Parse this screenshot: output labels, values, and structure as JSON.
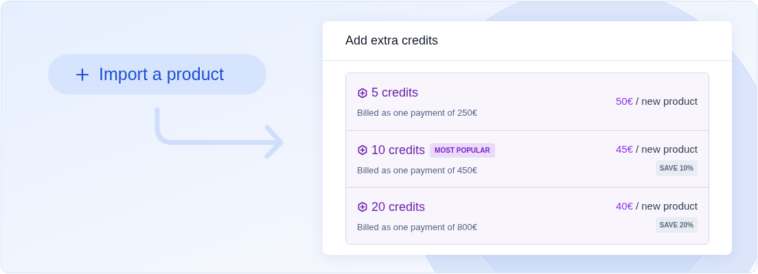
{
  "import_button": {
    "label": "Import a product"
  },
  "card": {
    "title": "Add extra credits",
    "plans": [
      {
        "name": "5 credits",
        "billing": "Billed as one payment of 250€",
        "price": "50€",
        "unit": "/ new product"
      },
      {
        "name": "10 credits",
        "badge": "MOST POPULAR",
        "billing": "Billed as one payment of 450€",
        "price": "45€",
        "unit": "/ new product",
        "save": "SAVE 10%"
      },
      {
        "name": "20 credits",
        "billing": "Billed as one payment of 800€",
        "price": "40€",
        "unit": "/ new product",
        "save": "SAVE 20%"
      }
    ]
  }
}
